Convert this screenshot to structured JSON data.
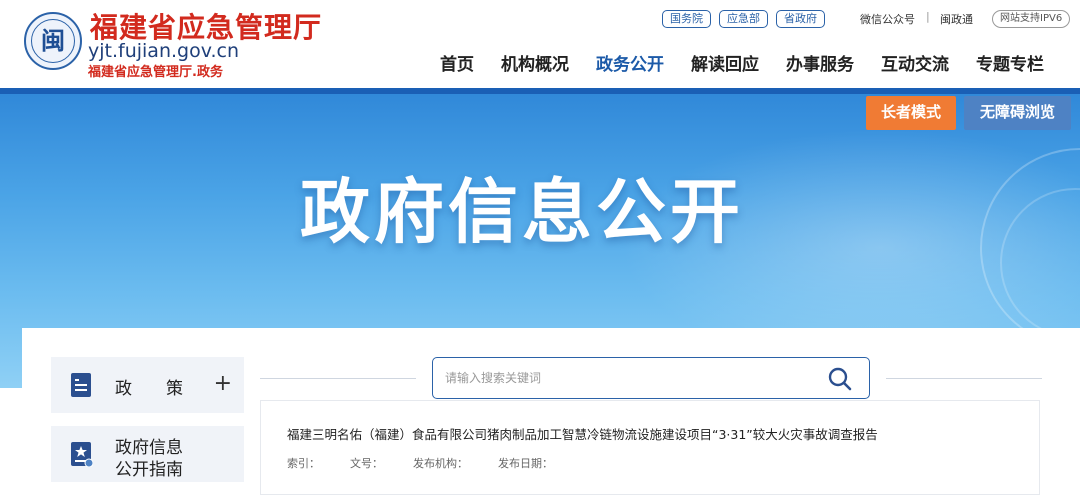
{
  "header": {
    "title": "福建省应急管理厅",
    "domain": "yjt.fujian.gov.cn",
    "subtitle": "福建省应急管理厅.政务",
    "logo_glyph": "闽",
    "quick_links": [
      "国务院",
      "应急部",
      "省政府"
    ],
    "wechat": "微信公众号",
    "separator": "|",
    "minzhengtong": "闽政通",
    "ipv6": "网站支持IPV6"
  },
  "nav": {
    "items": [
      "首页",
      "机构概况",
      "政务公开",
      "解读回应",
      "办事服务",
      "互动交流",
      "专题专栏"
    ],
    "active_index": 2
  },
  "banner": {
    "title": "政府信息公开",
    "elder_mode": "长者模式",
    "accessible": "无障碍浏览"
  },
  "sidebar": {
    "items": [
      {
        "label": "政　　策",
        "expand": "+"
      },
      {
        "label_line1": "政府信息",
        "label_line2": "公开指南"
      }
    ]
  },
  "search": {
    "placeholder": "请输入搜索关键词"
  },
  "document": {
    "title": "福建三明名佑（福建）食品有限公司猪肉制品加工智慧冷链物流设施建设项目“3·31”较大火灾事故调查报告",
    "meta": {
      "index": "索引：",
      "doc_no": "文号：",
      "issuer": "发布机构：",
      "date": "发布日期："
    }
  },
  "colors": {
    "brand_red": "#d22a1e",
    "brand_blue": "#2b62a8",
    "nav_active": "#1c5aa8",
    "elder_button": "#f07b34",
    "access_button": "#4e82c4"
  }
}
